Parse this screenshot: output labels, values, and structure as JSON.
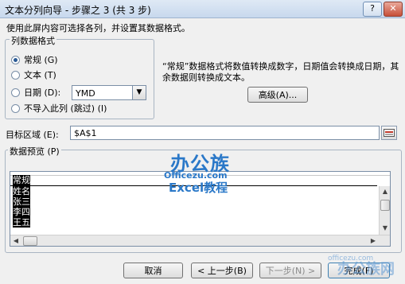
{
  "window": {
    "title": "文本分列向导 - 步骤之 3 (共 3 步)",
    "help_label": "?",
    "close_label": "✕"
  },
  "instruction": "使用此屏内容可选择各列，并设置其数据格式。",
  "column_format": {
    "group_label": "列数据格式",
    "options": [
      {
        "label": "常规 (G)",
        "selected": true
      },
      {
        "label": "文本 (T)",
        "selected": false
      },
      {
        "label": "日期 (D):",
        "selected": false
      },
      {
        "label": "不导入此列 (跳过) (I)",
        "selected": false
      }
    ],
    "date_format": "YMD"
  },
  "description": "“常规”数据格式将数值转换成数字，日期值会转换成日期，其余数据则转换成文本。",
  "advanced_button": "高级(A)...",
  "target": {
    "label": "目标区域 (E):",
    "value": "$A$1"
  },
  "preview": {
    "label": "数据预览 (P)",
    "header": "常规",
    "rows": [
      "常规",
      "姓名",
      "张三",
      "李四",
      "王五"
    ]
  },
  "buttons": {
    "cancel": "取消",
    "back": "< 上一步(B)",
    "next": "下一步(N) >",
    "finish": "完成(F)"
  },
  "watermarks": {
    "logo_cn": "办公族",
    "logo_site": "Officezu.com",
    "logo_excel": "Excel教程",
    "corner_site": "officezu.com",
    "corner_brand": "办公族网"
  }
}
